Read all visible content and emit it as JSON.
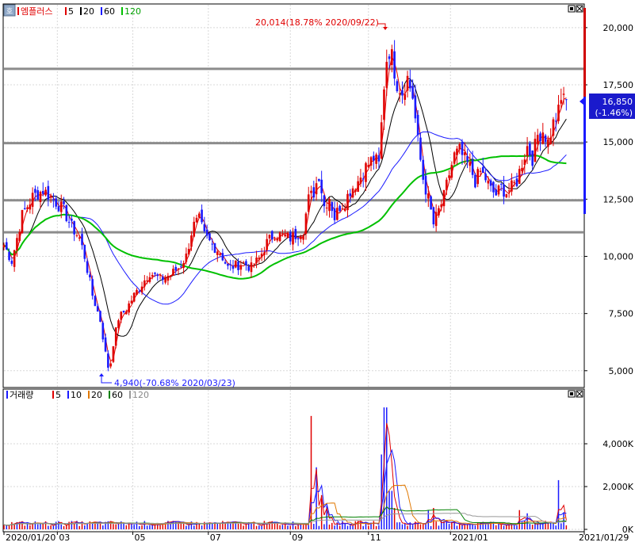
{
  "price_legend": {
    "name": "엠플러스",
    "items": [
      {
        "label": "5",
        "color": "#e00000"
      },
      {
        "label": "20",
        "color": "#000000"
      },
      {
        "label": "60",
        "color": "#1a1aff"
      },
      {
        "label": "120",
        "color": "#00c000"
      }
    ]
  },
  "volume_legend": {
    "name": "거래량",
    "items": [
      {
        "label": "5",
        "color": "#e00000"
      },
      {
        "label": "10",
        "color": "#1a1aff"
      },
      {
        "label": "20",
        "color": "#e07800"
      },
      {
        "label": "60",
        "color": "#008000"
      },
      {
        "label": "120",
        "color": "#999999"
      }
    ]
  },
  "annotations": {
    "high": "20,014(18.78% 2020/09/22)",
    "low": "4,940(-70.68% 2020/03/23)"
  },
  "current": {
    "price": "16,850",
    "change": "(-1.46%)"
  },
  "chart_data": [
    {
      "type": "candlestick",
      "ylim": [
        4300,
        21000
      ],
      "y_ticks": [
        5000,
        7500,
        10000,
        12500,
        15000,
        17500,
        20000
      ],
      "y_tick_labels": [
        "5,000",
        "7,500",
        "10,000",
        "12,500",
        "15,000",
        "17,500",
        "20,000"
      ],
      "horizontal_lines": [
        18200,
        14950,
        12450,
        11050
      ],
      "x_labels": [
        "2020/01/20",
        "03",
        "05",
        "07",
        "09",
        "11",
        "2021/01",
        "2021/01/29"
      ],
      "colors": {
        "up": "#e00000",
        "down": "#1a1aff",
        "horizontal_line": "#8c8c8c"
      },
      "anchors": [
        {
          "d": 0,
          "p": 10500
        },
        {
          "d": 6,
          "p": 9800
        },
        {
          "d": 14,
          "p": 11800
        },
        {
          "d": 22,
          "p": 12600
        },
        {
          "d": 30,
          "p": 12900
        },
        {
          "d": 38,
          "p": 12500
        },
        {
          "d": 46,
          "p": 12000
        },
        {
          "d": 52,
          "p": 11300
        },
        {
          "d": 58,
          "p": 10800
        },
        {
          "d": 62,
          "p": 10000
        },
        {
          "d": 68,
          "p": 8300
        },
        {
          "d": 74,
          "p": 7200
        },
        {
          "d": 79,
          "p": 5400
        },
        {
          "d": 81,
          "p": 4940
        },
        {
          "d": 84,
          "p": 6200
        },
        {
          "d": 88,
          "p": 7300
        },
        {
          "d": 94,
          "p": 7700
        },
        {
          "d": 100,
          "p": 8300
        },
        {
          "d": 106,
          "p": 8800
        },
        {
          "d": 112,
          "p": 9300
        },
        {
          "d": 120,
          "p": 9000
        },
        {
          "d": 128,
          "p": 9200
        },
        {
          "d": 134,
          "p": 9500
        },
        {
          "d": 140,
          "p": 10000
        },
        {
          "d": 145,
          "p": 11300
        },
        {
          "d": 150,
          "p": 11600
        },
        {
          "d": 154,
          "p": 10900
        },
        {
          "d": 160,
          "p": 10500
        },
        {
          "d": 166,
          "p": 10200
        },
        {
          "d": 172,
          "p": 9500
        },
        {
          "d": 178,
          "p": 9600
        },
        {
          "d": 184,
          "p": 9700
        },
        {
          "d": 190,
          "p": 9500
        },
        {
          "d": 196,
          "p": 9900
        },
        {
          "d": 202,
          "p": 10600
        },
        {
          "d": 208,
          "p": 11000
        },
        {
          "d": 214,
          "p": 10900
        },
        {
          "d": 220,
          "p": 10800
        },
        {
          "d": 226,
          "p": 11000
        },
        {
          "d": 230,
          "p": 11200
        },
        {
          "d": 234,
          "p": 12500
        },
        {
          "d": 238,
          "p": 12800
        },
        {
          "d": 242,
          "p": 13600
        },
        {
          "d": 246,
          "p": 12200
        },
        {
          "d": 250,
          "p": 12600
        },
        {
          "d": 254,
          "p": 11700
        },
        {
          "d": 258,
          "p": 12200
        },
        {
          "d": 262,
          "p": 12400
        },
        {
          "d": 266,
          "p": 12900
        },
        {
          "d": 272,
          "p": 13300
        },
        {
          "d": 278,
          "p": 13900
        },
        {
          "d": 284,
          "p": 14300
        },
        {
          "d": 288,
          "p": 14000
        },
        {
          "d": 292,
          "p": 17500
        },
        {
          "d": 295,
          "p": 19200
        },
        {
          "d": 298,
          "p": 18700
        },
        {
          "d": 302,
          "p": 17600
        },
        {
          "d": 306,
          "p": 17200
        },
        {
          "d": 310,
          "p": 17800
        },
        {
          "d": 314,
          "p": 17000
        },
        {
          "d": 318,
          "p": 15000
        },
        {
          "d": 322,
          "p": 13400
        },
        {
          "d": 326,
          "p": 12500
        },
        {
          "d": 330,
          "p": 11400
        },
        {
          "d": 334,
          "p": 12000
        },
        {
          "d": 338,
          "p": 12600
        },
        {
          "d": 342,
          "p": 13600
        },
        {
          "d": 346,
          "p": 14400
        },
        {
          "d": 350,
          "p": 14600
        },
        {
          "d": 354,
          "p": 14200
        },
        {
          "d": 358,
          "p": 13900
        },
        {
          "d": 362,
          "p": 13300
        },
        {
          "d": 366,
          "p": 13700
        },
        {
          "d": 370,
          "p": 13400
        },
        {
          "d": 374,
          "p": 12900
        },
        {
          "d": 378,
          "p": 12700
        },
        {
          "d": 382,
          "p": 13000
        },
        {
          "d": 386,
          "p": 12800
        },
        {
          "d": 390,
          "p": 13000
        },
        {
          "d": 394,
          "p": 13300
        },
        {
          "d": 398,
          "p": 14100
        },
        {
          "d": 402,
          "p": 14800
        },
        {
          "d": 406,
          "p": 14300
        },
        {
          "d": 410,
          "p": 15300
        },
        {
          "d": 414,
          "p": 15500
        },
        {
          "d": 418,
          "p": 15000
        },
        {
          "d": 422,
          "p": 15800
        },
        {
          "d": 426,
          "p": 16300
        },
        {
          "d": 430,
          "p": 17200
        },
        {
          "d": 432,
          "p": 16850
        }
      ],
      "day_range": [
        0,
        433
      ],
      "x_label_days": [
        0,
        41,
        99,
        157,
        220,
        280,
        343,
        374
      ]
    },
    {
      "type": "bar",
      "ylim": [
        0,
        6000000
      ],
      "y_ticks": [
        0,
        2000000,
        4000000
      ],
      "y_tick_labels": [
        "0K",
        "2,000K",
        "4,000K"
      ],
      "spikes": [
        {
          "d": 236,
          "v": 5300000
        },
        {
          "d": 240,
          "v": 2900000
        },
        {
          "d": 244,
          "v": 1600000
        },
        {
          "d": 248,
          "v": 1100000
        },
        {
          "d": 290,
          "v": 3500000
        },
        {
          "d": 293,
          "v": 5700000
        },
        {
          "d": 297,
          "v": 1800000
        },
        {
          "d": 300,
          "v": 1000000
        },
        {
          "d": 326,
          "v": 900000
        },
        {
          "d": 330,
          "v": 1000000
        },
        {
          "d": 396,
          "v": 900000
        },
        {
          "d": 402,
          "v": 750000
        },
        {
          "d": 426,
          "v": 2300000
        },
        {
          "d": 430,
          "v": 800000
        }
      ]
    }
  ]
}
